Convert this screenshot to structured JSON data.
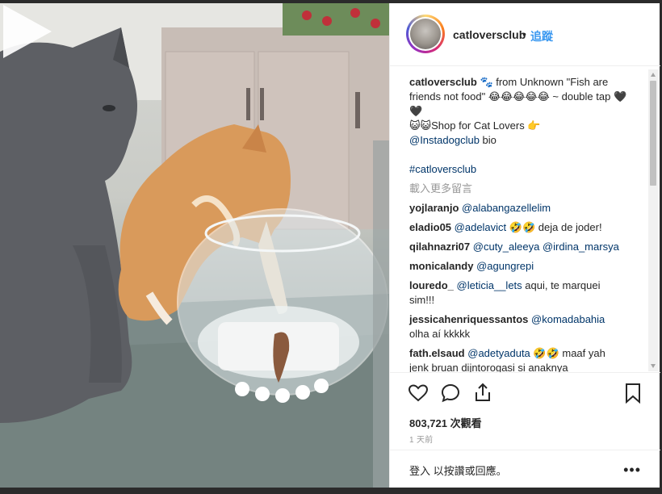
{
  "post": {
    "username": "catloversclub",
    "separator": "•",
    "follow_label": "追蹤"
  },
  "caption": {
    "username": "catloversclub",
    "text_1": " 🐾 from Unknown \"Fish are friends not food\" 😂😂😂😂😂 ~ double tap 🖤🖤",
    "text_2": "😺😺Shop for Cat Lovers 👉",
    "mention": "@Instadogclub",
    "text_3": " bio",
    "hashtag": "#catloversclub"
  },
  "load_more": "載入更多留言",
  "comments": [
    {
      "user": "yojlaranjo",
      "mention": "@alabangazellelim",
      "text": ""
    },
    {
      "user": "eladio05",
      "mention": "@adelavict",
      "text": " 🤣🤣 deja de joder!"
    },
    {
      "user": "qilahnazri07",
      "mention": "@cuty_aleeya @irdina_marsya",
      "text": ""
    },
    {
      "user": "monicalandy",
      "mention": "@agungrepi",
      "text": ""
    },
    {
      "user": "louredo_",
      "mention": "@leticia__lets",
      "text": " aqui, te marquei sim!!!"
    },
    {
      "user": "jessicahenriquessantos",
      "mention": "@komadabahia",
      "text": " olha aí kkkkk"
    },
    {
      "user": "fath.elsaud",
      "mention": "@adetyaduta",
      "text": " 🤣🤣 maaf yah jenk bruan dijntorogasi si anaknya"
    }
  ],
  "stats": {
    "views": "803,721 次觀看",
    "time_ago": "1 天前"
  },
  "footer": {
    "login_text": "登入 以按讚或回應。",
    "more": "•••"
  },
  "icons": {
    "like": "heart-icon",
    "comment": "comment-icon",
    "share": "share-icon",
    "save": "bookmark-icon",
    "play": "play-icon"
  }
}
